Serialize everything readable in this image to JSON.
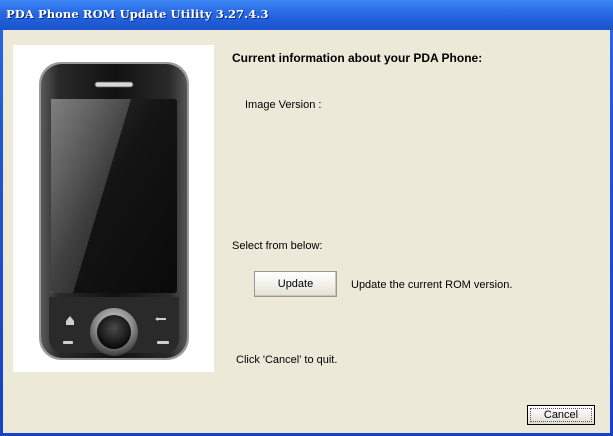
{
  "window": {
    "title": "PDA Phone ROM Update Utility 3.27.4.3"
  },
  "main": {
    "heading": "Current information about your PDA Phone:",
    "image_version_label": "Image Version :",
    "select_prompt": "Select from below:",
    "update_button": "Update",
    "update_description": "Update the current ROM version.",
    "quit_hint": "Click 'Cancel' to quit.",
    "cancel_button": "Cancel"
  },
  "colors": {
    "titlebar": "#2b6fe6",
    "client_background": "#ece9d8",
    "phone_body": "#1b1b1b"
  }
}
